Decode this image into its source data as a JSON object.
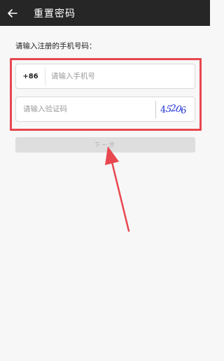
{
  "header": {
    "back_icon": "arrow-left-icon",
    "title": "重置密码"
  },
  "form": {
    "prompt": "请输入注册的手机号码：",
    "phone": {
      "prefix": "+86",
      "placeholder": "请输入手机号",
      "value": ""
    },
    "code": {
      "placeholder": "请输入验证码",
      "value": "",
      "captcha_text": "45206"
    },
    "next_label": "下一步",
    "next_enabled": false
  },
  "annotation": {
    "color": "#e8474f"
  }
}
